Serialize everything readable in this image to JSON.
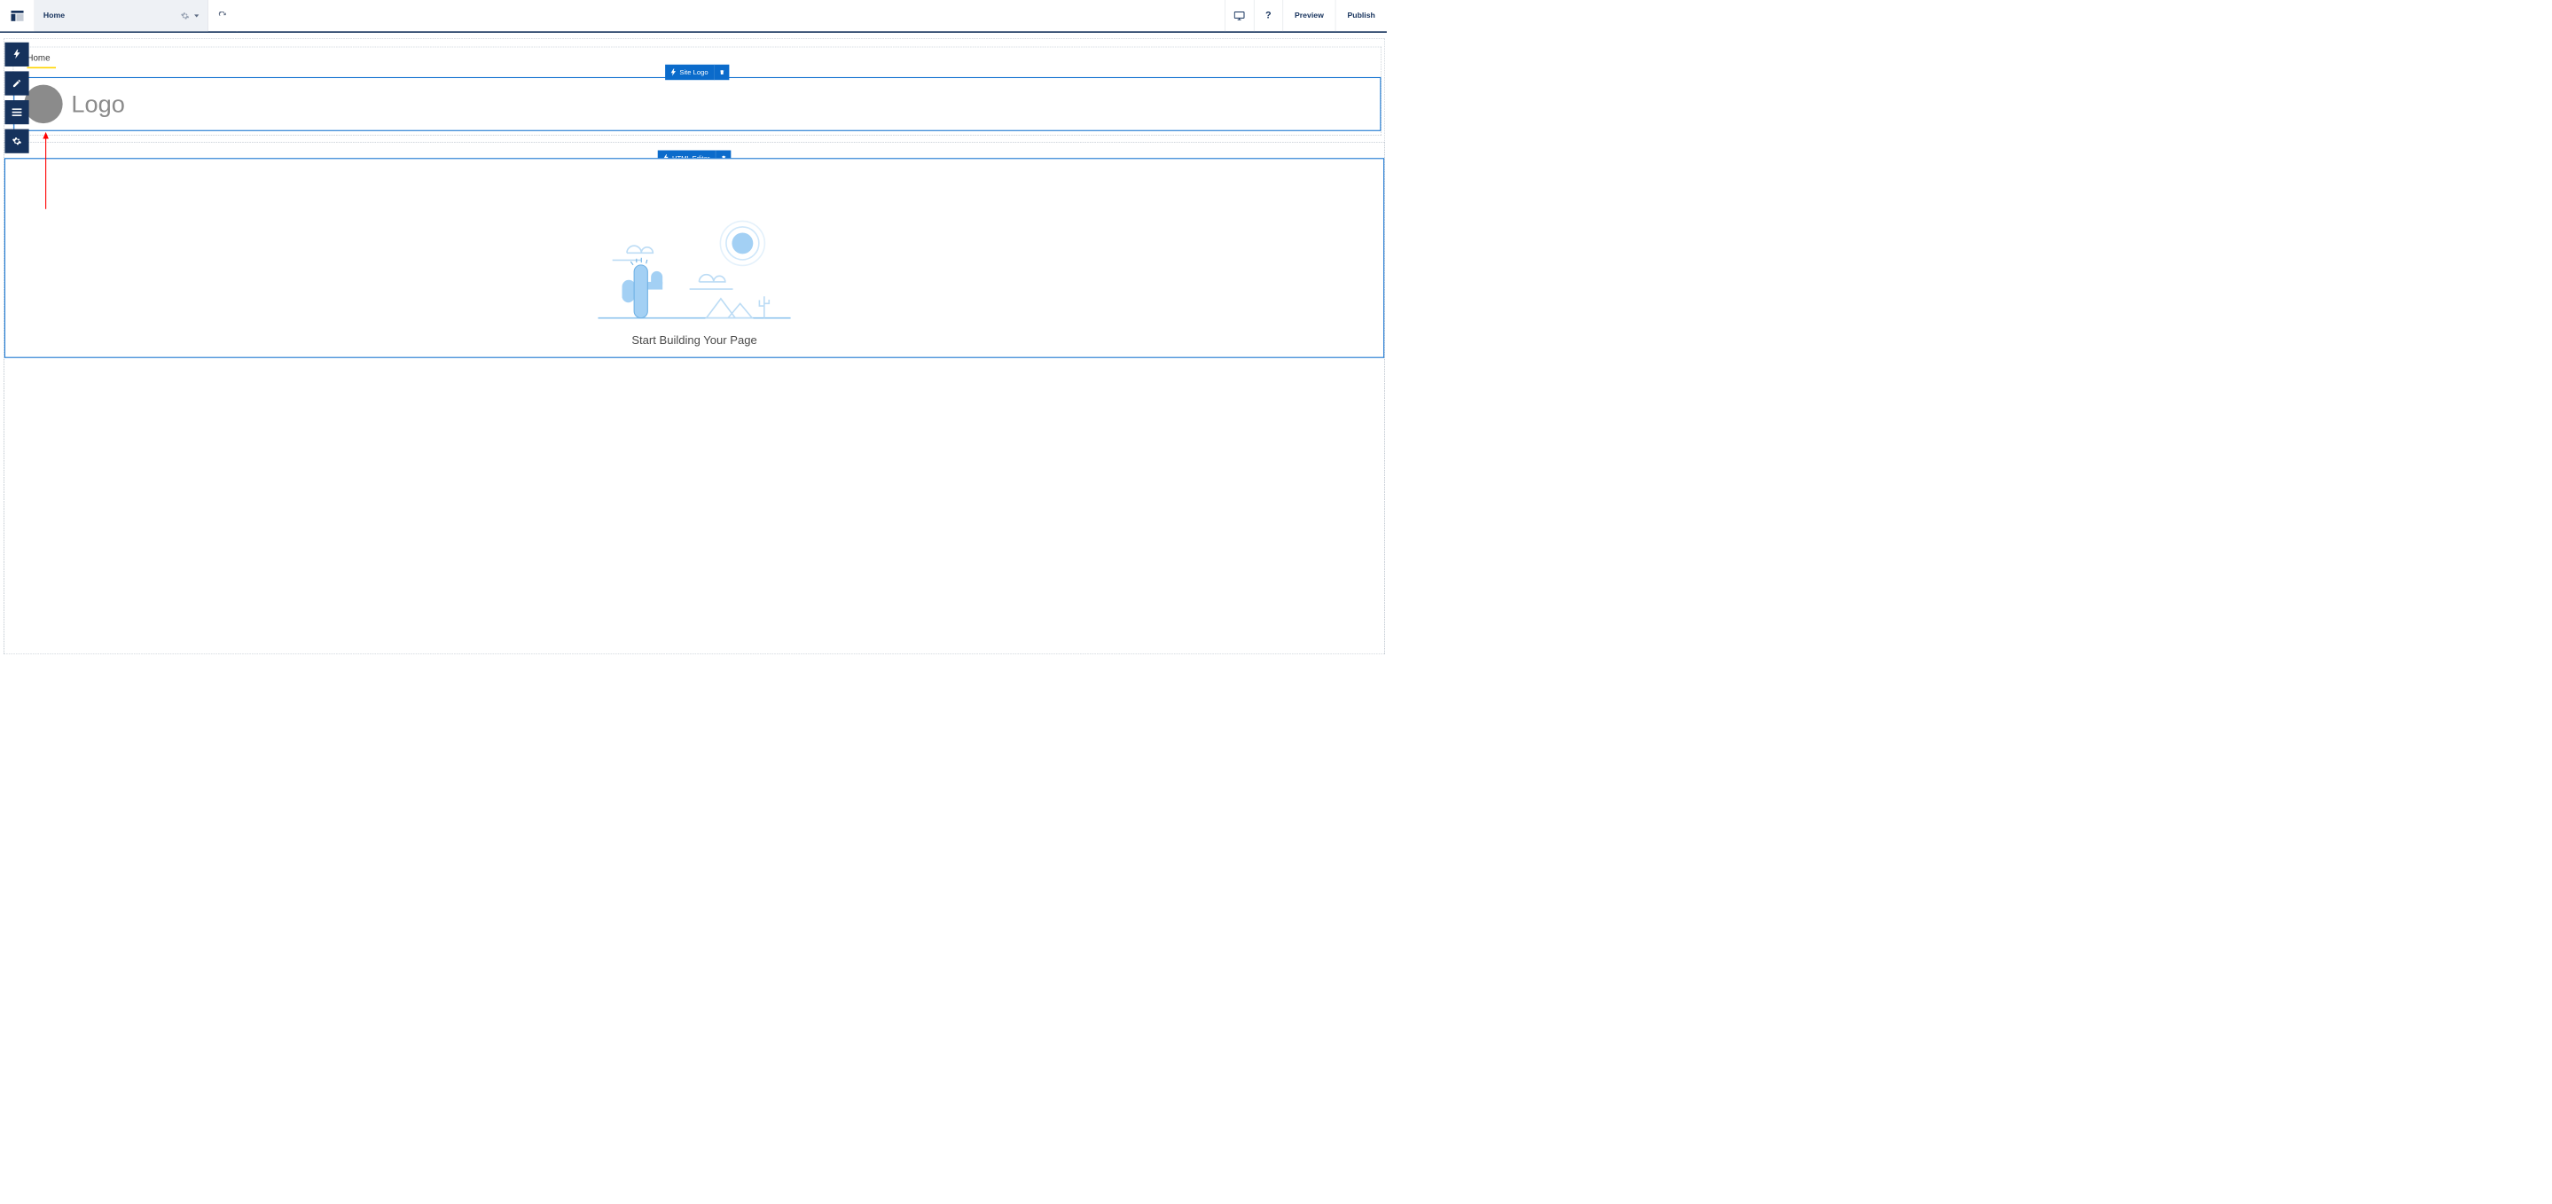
{
  "topbar": {
    "page_name": "Home",
    "preview_label": "Preview",
    "publish_label": "Publish",
    "help_label": "?",
    "icons": {
      "logo": "layout-icon",
      "gear": "gear-icon",
      "dropdown": "dropdown-caret",
      "refresh": "refresh-icon",
      "desktop": "desktop-icon",
      "help": "help-icon"
    }
  },
  "side_palette": [
    {
      "name": "components",
      "icon": "lightning-icon"
    },
    {
      "name": "theme",
      "icon": "pencil-icon"
    },
    {
      "name": "page-structure",
      "icon": "menu-icon"
    },
    {
      "name": "settings",
      "icon": "gear-icon"
    }
  ],
  "canvas": {
    "breadcrumb": "Home",
    "site_logo": {
      "tag_label": "Site Logo",
      "logo_text": "Logo"
    },
    "html_editor": {
      "tag_label": "HTML Editor",
      "placeholder_heading": "Start Building Your Page"
    }
  },
  "colors": {
    "primary": "#0b6bcb",
    "dark": "#16325c",
    "select_border": "#1875d1",
    "accent_yellow": "#ffd500"
  }
}
